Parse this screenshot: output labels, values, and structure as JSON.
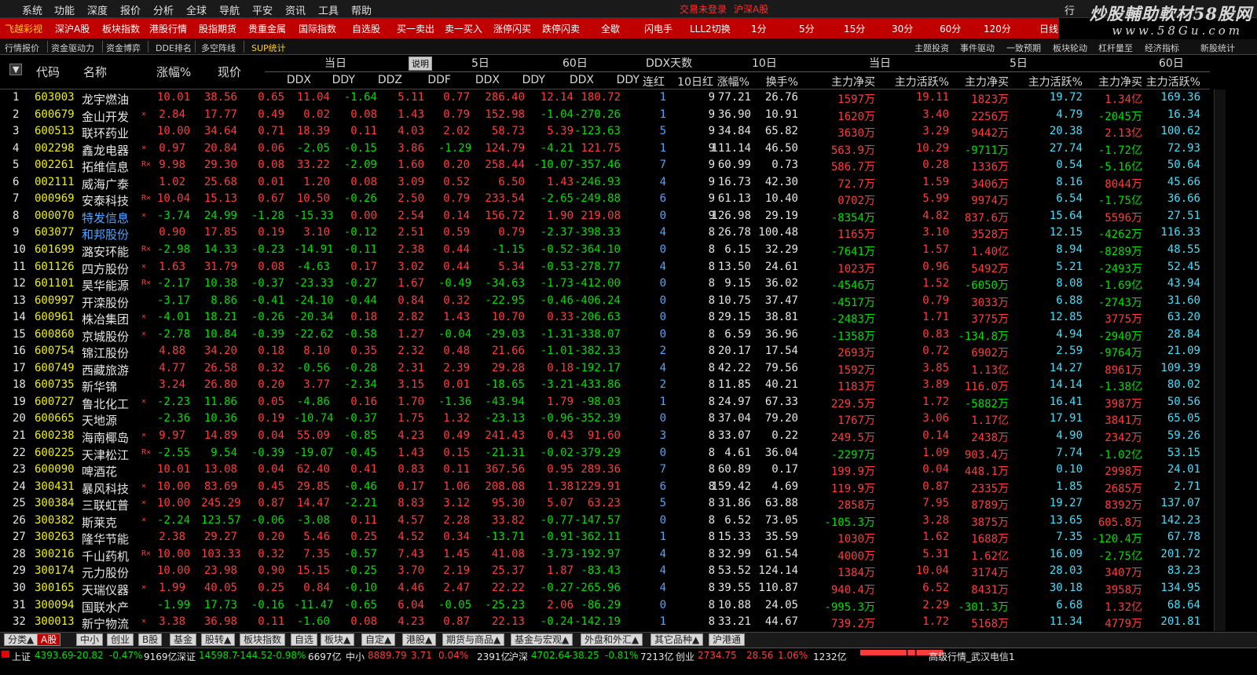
{
  "menu": [
    "系统",
    "功能",
    "深度",
    "报价",
    "分析",
    "全球",
    "导航",
    "平安",
    "资讯",
    "工具",
    "帮助"
  ],
  "menu_red": [
    "交易未登录",
    "沪深A股"
  ],
  "corner": "行",
  "watermark": {
    "line1": "炒股輔助軟材58股网",
    "line2": "www.58Gu.com"
  },
  "tabs": [
    "飞越彩视",
    "深沪A股",
    "板块指数",
    "港股行情",
    "股指期货",
    "贵重金属",
    "国际指数",
    "自选股",
    "买一卖出",
    "卖一买入",
    "涨停闪买",
    "跌停闪卖",
    "全歇",
    "闪电手",
    "LLL2切换",
    "1分",
    "5分",
    "15分",
    "30分",
    "60分",
    "120分",
    "日线"
  ],
  "subtabs_left": [
    "行情报价",
    "资金驱动力",
    "资金博弈",
    "DDE排名",
    "多空阵线",
    "SUP统计"
  ],
  "subtabs_right": [
    "主题投资",
    "事件驱动",
    "一致预期",
    "板块轮动",
    "杠杆量至",
    "经济指标",
    "新股统计"
  ],
  "header": {
    "groups": [
      "当日",
      "说明",
      "5日",
      "60日",
      "DDX天数",
      "10日",
      "当日",
      "5日",
      "60日"
    ],
    "cols": [
      "代码",
      "名称",
      "涨幅%",
      "现价",
      "DDX",
      "DDY",
      "DDZ",
      "DDF",
      "DDX",
      "DDY",
      "DDX",
      "DDY",
      "连红",
      "10日红",
      "涨幅%",
      "换手%",
      "主力净买",
      "主力活跃%",
      "主力净买",
      "主力活跃%",
      "主力净买",
      "主力活跃%"
    ]
  },
  "colors": {
    "up": "#ff3c3c",
    "down": "#00e000",
    "neutral": "#e6e6e6",
    "code": "#f0f000",
    "accent": "#c00000",
    "money": "#40e0ff"
  },
  "rows": [
    [
      "1",
      "603003",
      "龙宇燃油",
      "",
      "10.01",
      "38.56",
      "0.65",
      "11.04",
      "-1.64",
      "5.11",
      "0.77",
      "286.40",
      "12.14",
      "180.72",
      "1",
      "9",
      "77.21",
      "26.76",
      "1597万",
      "19.11",
      "1823万",
      "19.72",
      "1.34亿",
      "169.36"
    ],
    [
      "2",
      "600679",
      "金山开发",
      "×",
      "2.84",
      "17.77",
      "0.49",
      "0.02",
      "0.08",
      "1.43",
      "0.79",
      "152.98",
      "-1.04",
      "-270.26",
      "1",
      "9",
      "36.90",
      "10.91",
      "1620万",
      "3.40",
      "2256万",
      "4.79",
      "-2045万",
      "16.34"
    ],
    [
      "3",
      "600513",
      "联环药业",
      "",
      "10.00",
      "34.64",
      "0.71",
      "18.39",
      "0.11",
      "4.03",
      "2.02",
      "58.73",
      "5.39",
      "-123.63",
      "5",
      "9",
      "34.84",
      "65.82",
      "3630万",
      "3.29",
      "9442万",
      "20.38",
      "2.13亿",
      "100.62"
    ],
    [
      "4",
      "002298",
      "鑫龙电器",
      "×",
      "0.97",
      "20.84",
      "0.06",
      "-2.05",
      "-0.15",
      "3.86",
      "-1.29",
      "124.79",
      "-4.21",
      "121.75",
      "1",
      "9",
      "111.14",
      "46.50",
      "563.9万",
      "10.29",
      "-9711万",
      "27.74",
      "-1.72亿",
      "72.93"
    ],
    [
      "5",
      "002261",
      "拓维信息",
      "R×",
      "9.98",
      "29.30",
      "0.08",
      "33.22",
      "-2.09",
      "1.60",
      "0.20",
      "258.44",
      "-10.07",
      "-357.46",
      "7",
      "9",
      "60.99",
      "0.73",
      "586.7万",
      "0.28",
      "1336万",
      "0.54",
      "-5.16亿",
      "50.64"
    ],
    [
      "6",
      "002111",
      "威海广泰",
      "",
      "1.02",
      "25.68",
      "0.01",
      "1.20",
      "0.08",
      "3.09",
      "0.52",
      "6.50",
      "1.43",
      "-246.93",
      "4",
      "9",
      "16.73",
      "42.30",
      "72.7万",
      "1.59",
      "3406万",
      "8.16",
      "8044万",
      "45.66"
    ],
    [
      "7",
      "000969",
      "安泰科技",
      "R×",
      "10.04",
      "15.13",
      "0.67",
      "10.50",
      "-0.26",
      "2.50",
      "0.79",
      "233.54",
      "-2.65",
      "-249.88",
      "6",
      "9",
      "61.13",
      "10.40",
      "0702万",
      "5.99",
      "9974万",
      "6.54",
      "-1.75亿",
      "36.66"
    ],
    [
      "8",
      "000070",
      "特发信息",
      "×",
      "-3.74",
      "24.99",
      "-1.28",
      "-15.33",
      "0.00",
      "2.54",
      "0.14",
      "156.72",
      "1.90",
      "219.08",
      "0",
      "9",
      "126.98",
      "29.19",
      "-8354万",
      "4.82",
      "837.6万",
      "15.64",
      "5596万",
      "27.51"
    ],
    [
      "9",
      "603077",
      "和邦股份",
      "",
      "0.90",
      "17.85",
      "0.19",
      "3.10",
      "-0.12",
      "2.51",
      "0.59",
      "0.79",
      "-2.37",
      "-398.33",
      "4",
      "8",
      "26.78",
      "100.48",
      "1165万",
      "3.10",
      "3528万",
      "12.15",
      "-4262万",
      "116.33"
    ],
    [
      "10",
      "601699",
      "潞安环能",
      "R×",
      "-2.98",
      "14.33",
      "-0.23",
      "-14.91",
      "-0.11",
      "2.38",
      "0.44",
      "-1.15",
      "-0.52",
      "-364.10",
      "0",
      "8",
      "6.15",
      "32.29",
      "-7641万",
      "1.57",
      "1.40亿",
      "8.94",
      "-8289万",
      "48.55"
    ],
    [
      "11",
      "601126",
      "四方股份",
      "×",
      "1.63",
      "31.79",
      "0.08",
      "-4.63",
      "0.17",
      "3.02",
      "0.44",
      "5.34",
      "-0.53",
      "-278.77",
      "4",
      "8",
      "13.50",
      "24.61",
      "1023万",
      "0.96",
      "5492万",
      "5.21",
      "-2493万",
      "52.45"
    ],
    [
      "12",
      "601101",
      "昊华能源",
      "R×",
      "-2.17",
      "10.38",
      "-0.37",
      "-23.33",
      "-0.27",
      "1.67",
      "-0.49",
      "-34.63",
      "-1.73",
      "-412.00",
      "0",
      "8",
      "9.15",
      "36.02",
      "-4546万",
      "1.52",
      "-6050万",
      "8.08",
      "-1.69亿",
      "43.94"
    ],
    [
      "13",
      "600997",
      "开滦股份",
      "",
      "-3.17",
      "8.86",
      "-0.41",
      "-24.10",
      "-0.44",
      "0.84",
      "0.32",
      "-22.95",
      "-0.46",
      "-406.24",
      "0",
      "8",
      "10.75",
      "37.47",
      "-4517万",
      "0.79",
      "3033万",
      "6.88",
      "-2743万",
      "31.60"
    ],
    [
      "14",
      "600961",
      "株冶集团",
      "×",
      "-4.01",
      "18.21",
      "-0.26",
      "-20.34",
      "0.18",
      "2.82",
      "1.43",
      "10.70",
      "0.33",
      "-206.63",
      "0",
      "8",
      "29.15",
      "38.81",
      "-2483万",
      "1.71",
      "3775万",
      "12.85",
      "3775万",
      "63.20"
    ],
    [
      "15",
      "600860",
      "京城股份",
      "×",
      "-2.78",
      "10.84",
      "-0.39",
      "-22.62",
      "-0.58",
      "1.27",
      "-0.04",
      "-29.03",
      "-1.31",
      "-338.07",
      "0",
      "8",
      "6.59",
      "36.96",
      "-1358万",
      "0.83",
      "-134.8万",
      "4.94",
      "-2940万",
      "28.84"
    ],
    [
      "16",
      "600754",
      "锦江股份",
      "",
      "4.88",
      "34.20",
      "0.18",
      "8.10",
      "0.35",
      "2.32",
      "0.48",
      "21.66",
      "-1.01",
      "-382.33",
      "2",
      "8",
      "20.17",
      "17.54",
      "2693万",
      "0.72",
      "6902万",
      "2.59",
      "-9764万",
      "21.09"
    ],
    [
      "17",
      "600749",
      "西藏旅游",
      "",
      "4.77",
      "26.58",
      "0.32",
      "-0.56",
      "-0.28",
      "2.31",
      "2.39",
      "29.28",
      "0.18",
      "-192.17",
      "4",
      "8",
      "42.22",
      "79.56",
      "1592万",
      "3.85",
      "1.13亿",
      "14.27",
      "8961万",
      "109.39"
    ],
    [
      "18",
      "600735",
      "新华锦",
      "",
      "3.24",
      "26.80",
      "0.20",
      "3.77",
      "-2.34",
      "3.15",
      "0.01",
      "-18.65",
      "-3.21",
      "-433.86",
      "2",
      "8",
      "11.85",
      "40.21",
      "1183万",
      "3.89",
      "116.0万",
      "14.14",
      "-1.38亿",
      "80.02"
    ],
    [
      "19",
      "600727",
      "鲁北化工",
      "×",
      "-2.23",
      "11.86",
      "0.05",
      "-4.86",
      "0.16",
      "1.70",
      "-1.36",
      "-43.94",
      "1.79",
      "-98.03",
      "1",
      "8",
      "24.97",
      "67.33",
      "229.5万",
      "1.72",
      "-5882万",
      "16.41",
      "3987万",
      "50.56"
    ],
    [
      "20",
      "600665",
      "天地源",
      "",
      "-2.36",
      "10.36",
      "0.19",
      "-10.74",
      "-0.37",
      "1.75",
      "1.32",
      "-23.13",
      "-0.96",
      "-352.39",
      "0",
      "8",
      "37.04",
      "79.20",
      "1767万",
      "3.06",
      "1.17亿",
      "17.91",
      "3841万",
      "65.05"
    ],
    [
      "21",
      "600238",
      "海南椰岛",
      "×",
      "9.97",
      "14.89",
      "0.04",
      "55.09",
      "-0.85",
      "4.23",
      "0.49",
      "241.43",
      "0.43",
      "91.60",
      "3",
      "8",
      "33.07",
      "0.22",
      "249.5万",
      "0.14",
      "2438万",
      "4.90",
      "2342万",
      "59.26"
    ],
    [
      "22",
      "600225",
      "天津松江",
      "R×",
      "-2.55",
      "9.54",
      "-0.39",
      "-19.07",
      "-0.45",
      "1.43",
      "0.15",
      "-21.31",
      "-0.02",
      "-379.29",
      "0",
      "8",
      "4.61",
      "36.04",
      "-2297万",
      "1.09",
      "903.4万",
      "7.74",
      "-1.02亿",
      "53.15"
    ],
    [
      "23",
      "600090",
      "啤酒花",
      "",
      "10.01",
      "13.08",
      "0.04",
      "62.40",
      "0.41",
      "0.83",
      "0.11",
      "367.56",
      "0.95",
      "289.36",
      "7",
      "8",
      "60.89",
      "0.17",
      "199.9万",
      "0.04",
      "448.1万",
      "0.10",
      "2998万",
      "24.01"
    ],
    [
      "24",
      "300431",
      "暴风科技",
      "×",
      "10.00",
      "83.69",
      "0.45",
      "29.85",
      "-0.46",
      "0.17",
      "1.06",
      "208.08",
      "1.38",
      "1229.91",
      "6",
      "8",
      "159.42",
      "4.69",
      "119.9万",
      "0.87",
      "2335万",
      "1.85",
      "2685万",
      "2.71"
    ],
    [
      "25",
      "300384",
      "三联虹普",
      "×",
      "10.00",
      "245.29",
      "0.87",
      "14.47",
      "-2.21",
      "8.83",
      "3.12",
      "95.30",
      "5.07",
      "63.23",
      "5",
      "8",
      "31.86",
      "63.88",
      "2858万",
      "7.95",
      "8789万",
      "19.27",
      "8392万",
      "137.07"
    ],
    [
      "26",
      "300382",
      "斯莱克",
      "×",
      "-2.24",
      "123.57",
      "-0.06",
      "-3.08",
      "0.11",
      "4.57",
      "2.28",
      "33.82",
      "-0.77",
      "-147.57",
      "0",
      "8",
      "6.52",
      "73.05",
      "-105.3万",
      "3.28",
      "3875万",
      "13.65",
      "605.8万",
      "142.23"
    ],
    [
      "27",
      "300263",
      "隆华节能",
      "",
      "2.38",
      "29.27",
      "0.20",
      "5.46",
      "0.25",
      "4.52",
      "0.34",
      "-13.71",
      "-0.91",
      "-362.11",
      "1",
      "8",
      "15.33",
      "35.59",
      "1030万",
      "1.62",
      "1688万",
      "7.35",
      "-120.4万",
      "67.78"
    ],
    [
      "28",
      "300216",
      "千山药机",
      "R×",
      "10.00",
      "103.33",
      "0.32",
      "7.35",
      "-0.57",
      "7.43",
      "1.45",
      "41.08",
      "-3.73",
      "-192.97",
      "4",
      "8",
      "32.99",
      "61.54",
      "4000万",
      "5.31",
      "1.62亿",
      "16.09",
      "-2.75亿",
      "201.72"
    ],
    [
      "29",
      "300174",
      "元力股份",
      "",
      "10.00",
      "23.98",
      "0.90",
      "15.15",
      "-0.25",
      "3.70",
      "2.19",
      "25.37",
      "1.87",
      "-83.43",
      "4",
      "8",
      "53.52",
      "124.14",
      "1384万",
      "10.04",
      "3174万",
      "28.03",
      "3407万",
      "83.23"
    ],
    [
      "30",
      "300165",
      "天瑞仪器",
      "×",
      "1.99",
      "40.05",
      "0.25",
      "0.84",
      "-0.10",
      "4.46",
      "2.47",
      "22.22",
      "-0.27",
      "-265.96",
      "4",
      "8",
      "39.55",
      "110.87",
      "940.4万",
      "6.52",
      "8431万",
      "30.18",
      "3958万",
      "134.95"
    ],
    [
      "31",
      "300094",
      "国联水产",
      "",
      "-1.99",
      "17.73",
      "-0.16",
      "-11.47",
      "-0.65",
      "6.04",
      "-0.05",
      "-25.23",
      "2.06",
      "-86.29",
      "0",
      "8",
      "10.88",
      "24.05",
      "-995.3万",
      "2.29",
      "-301.3万",
      "6.68",
      "1.32亿",
      "68.64"
    ],
    [
      "32",
      "300013",
      "新宁物流",
      "×",
      "3.38",
      "36.98",
      "0.11",
      "-1.60",
      "0.08",
      "4.23",
      "0.87",
      "22.13",
      "-0.24",
      "-142.19",
      "1",
      "8",
      "33.21",
      "44.67",
      "739.2万",
      "1.72",
      "5168万",
      "11.34",
      "4779万",
      "201.81"
    ]
  ],
  "blue_names": [
    "特发信息",
    "和邦股份"
  ],
  "bottom_tabs": [
    "分类▲",
    "A股",
    "中小",
    "创业",
    "B股",
    "基金",
    "股转▲",
    "板块指数",
    "自选",
    "板块▲",
    "自定▲",
    "港股▲",
    "期货与商品▲",
    "基金与宏观▲",
    "外盘和外汇▲",
    "其它品种▲",
    "沪港通"
  ],
  "status": {
    "sh": [
      "上证",
      "4393.69",
      "-20.82",
      "-0.47%",
      "9169亿"
    ],
    "sz": [
      "深证",
      "14598.7",
      "-144.52",
      "-0.98%",
      "6697亿"
    ],
    "zx": [
      "中小",
      "8889.79",
      "3.71",
      "0.04%",
      "2391亿"
    ],
    "hs": [
      "沪深",
      "4702.64",
      "-38.25",
      "-0.81%",
      "7213亿"
    ],
    "cy": [
      "创业",
      "2734.75",
      "28.56",
      "1.06%",
      "1232亿"
    ],
    "right": "高级行情_武汉电信1"
  }
}
